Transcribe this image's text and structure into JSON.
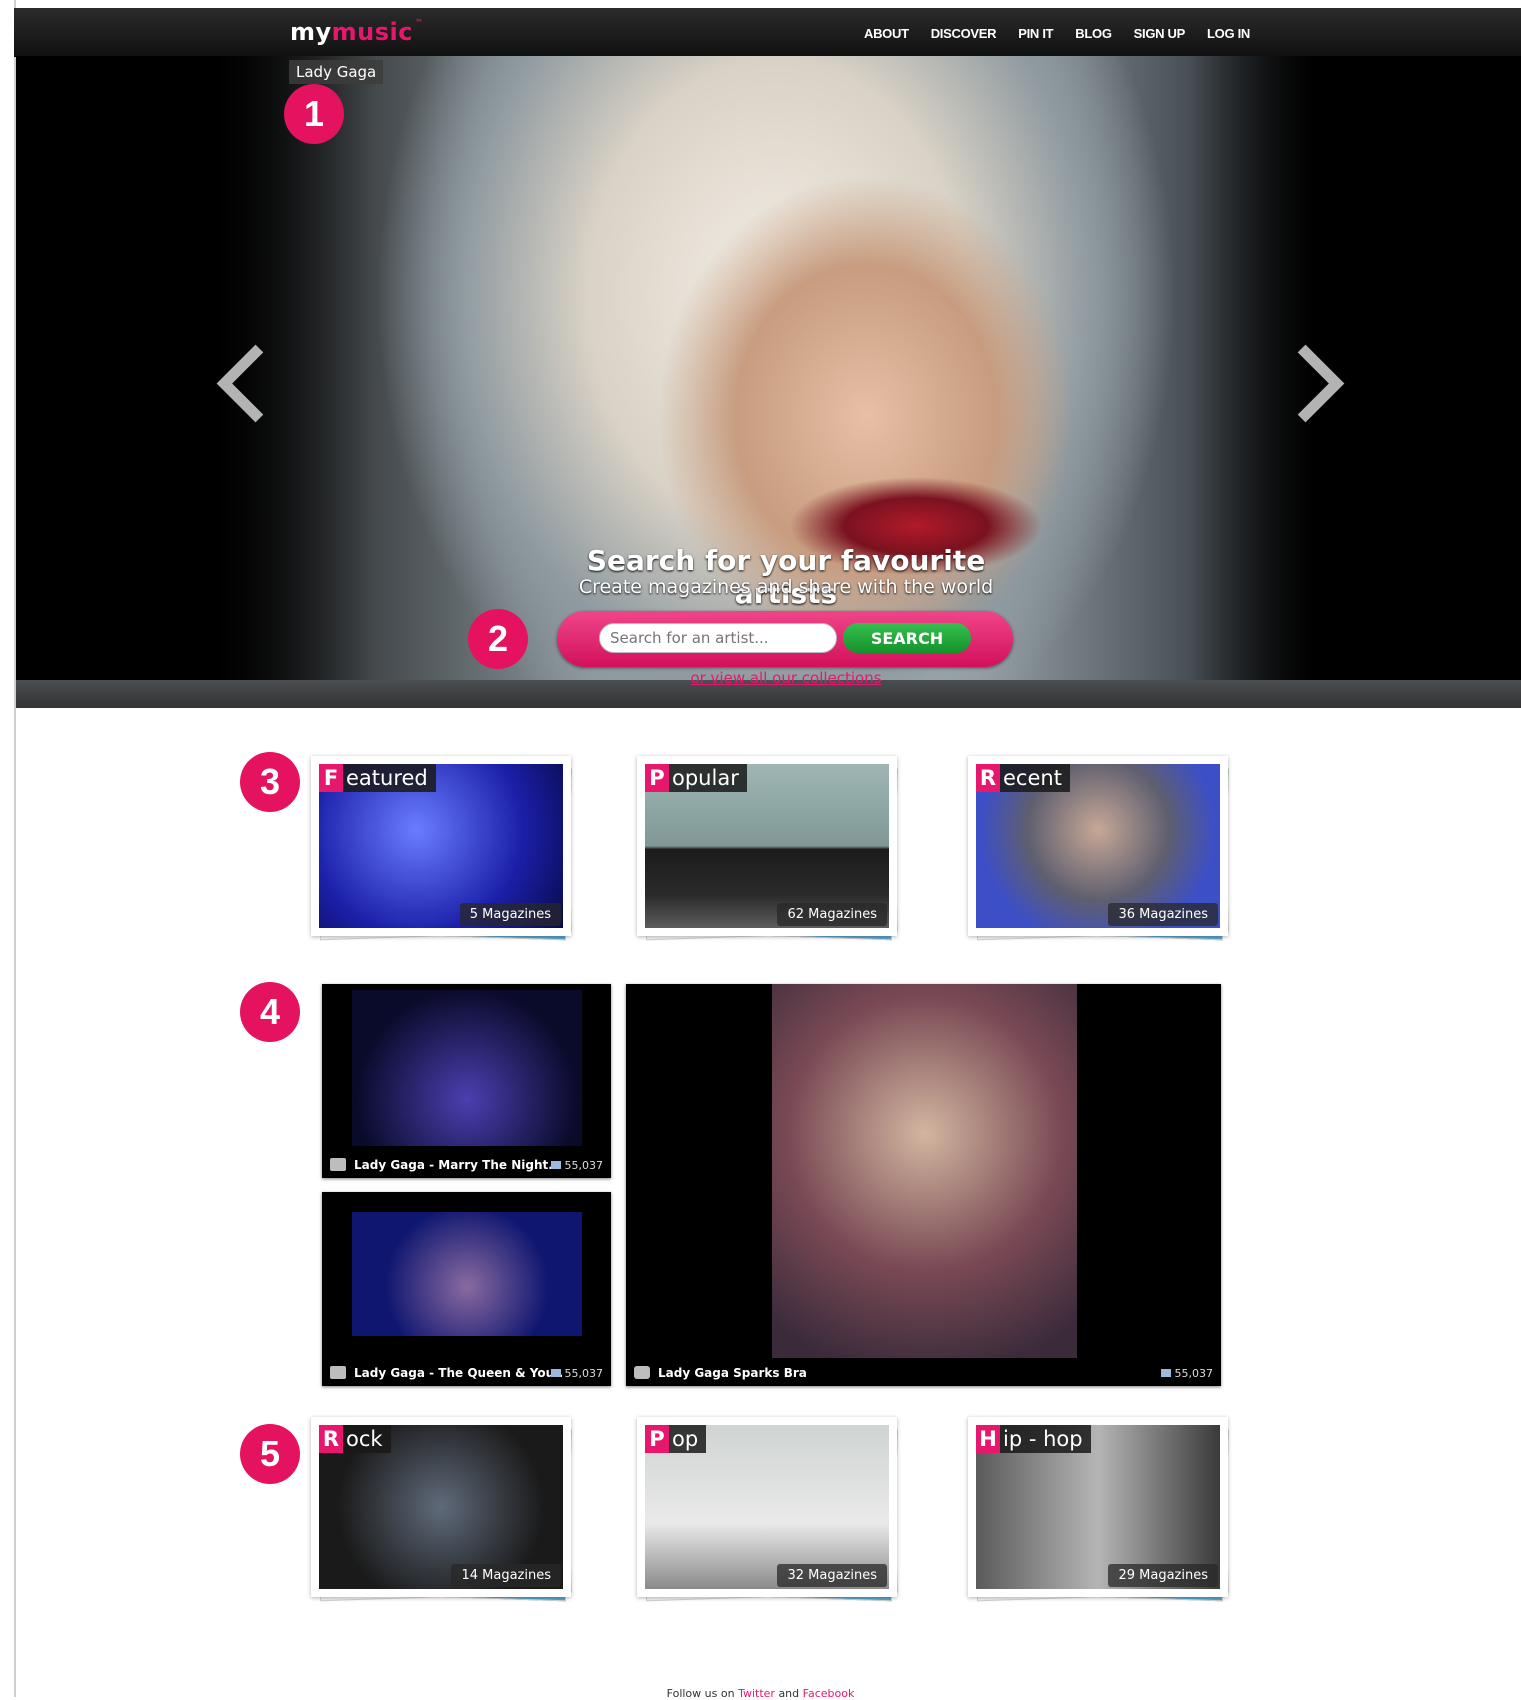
{
  "brand": {
    "my": "my",
    "music": "music",
    "tm": "™"
  },
  "nav": [
    "ABOUT",
    "DISCOVER",
    "PIN IT",
    "BLOG",
    "SIGN UP",
    "LOG IN"
  ],
  "hero": {
    "artist": "Lady Gaga",
    "title": "Search for your favourite artists",
    "subtitle": "Create magazines and share with the world",
    "search_placeholder": "Search for an artist...",
    "search_button": "SEARCH",
    "collections_link": "or view all our collections"
  },
  "badges": [
    "1",
    "2",
    "3",
    "4",
    "5"
  ],
  "categories": [
    {
      "initial": "F",
      "rest": "eatured",
      "count": "5 Magazines"
    },
    {
      "initial": "P",
      "rest": "opular",
      "count": "62 Magazines"
    },
    {
      "initial": "R",
      "rest": "ecent",
      "count": "36 Magazines"
    }
  ],
  "media": [
    {
      "title": "Lady Gaga - Marry The Night...",
      "comments": "55,037",
      "type": "video"
    },
    {
      "title": "Lady Gaga - The Queen & You..",
      "comments": "55,037",
      "type": "video"
    },
    {
      "title": "Lady Gaga Sparks Bra",
      "comments": "55,037",
      "type": "photo"
    }
  ],
  "genres": [
    {
      "initial": "R",
      "rest": "ock",
      "count": "14 Magazines"
    },
    {
      "initial": "P",
      "rest": "op",
      "count": "32 Magazines"
    },
    {
      "initial": "H",
      "rest": "ip - hop",
      "count": "29 Magazines"
    }
  ],
  "footer": {
    "prefix": "Follow us on",
    "twitter": "Twitter",
    "and": "and",
    "facebook": "Facebook"
  },
  "colors": {
    "accent": "#e8176e",
    "search_button": "#1fa83a",
    "nav_bg": "#1b1b1b"
  }
}
